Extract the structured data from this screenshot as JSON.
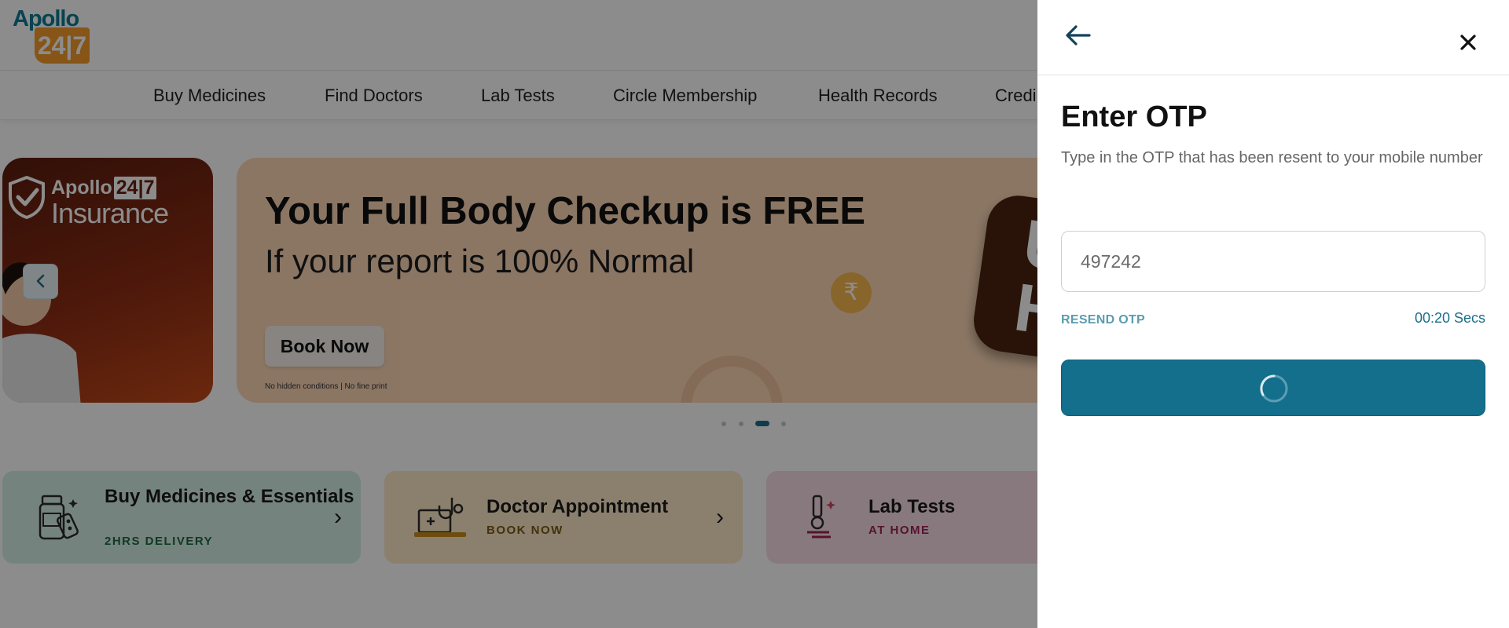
{
  "header": {
    "logo_top": "Apollo",
    "logo_bottom": "24|7"
  },
  "nav": {
    "items": [
      "Buy Medicines",
      "Find Doctors",
      "Lab Tests",
      "Circle Membership",
      "Health Records",
      "Credi"
    ]
  },
  "carousel": {
    "insurance_card": {
      "brand": "Apollo",
      "brand_badge": "24|7",
      "title": "Insurance"
    },
    "prev_icon": "chevron-left-icon",
    "banner": {
      "title": "Your Full Body Checkup is FREE",
      "subtitle": "If your report is 100% Normal",
      "cta": "Book Now",
      "fineprint": "No hidden conditions | No fine print",
      "coin_symbol": "₹",
      "badge_letters": "U\nH"
    },
    "dots": {
      "count": 4,
      "active_index": 2
    }
  },
  "tiles": [
    {
      "title": "Buy Medicines & Essentials",
      "subtitle": "2HRS DELIVERY",
      "subtitle_color": "#1e6b3c",
      "icon": "medicine-bottle-icon"
    },
    {
      "title": "Doctor Appointment",
      "subtitle": "BOOK NOW",
      "subtitle_color": "#7a5a14",
      "icon": "stethoscope-laptop-icon"
    },
    {
      "title": "Lab Tests",
      "subtitle": "AT HOME",
      "subtitle_color": "#9e2452",
      "icon": "microscope-icon"
    }
  ],
  "otp_drawer": {
    "back_icon": "arrow-left-icon",
    "close_icon": "close-icon",
    "title": "Enter OTP",
    "description": "Type in the OTP that has been resent to your mobile number",
    "otp_value": "497242",
    "resend_label": "RESEND OTP",
    "timer": "00:20 Secs",
    "submit_state": "loading",
    "colors": {
      "primary": "#136f8b",
      "resend": "#5a9cb0"
    }
  }
}
